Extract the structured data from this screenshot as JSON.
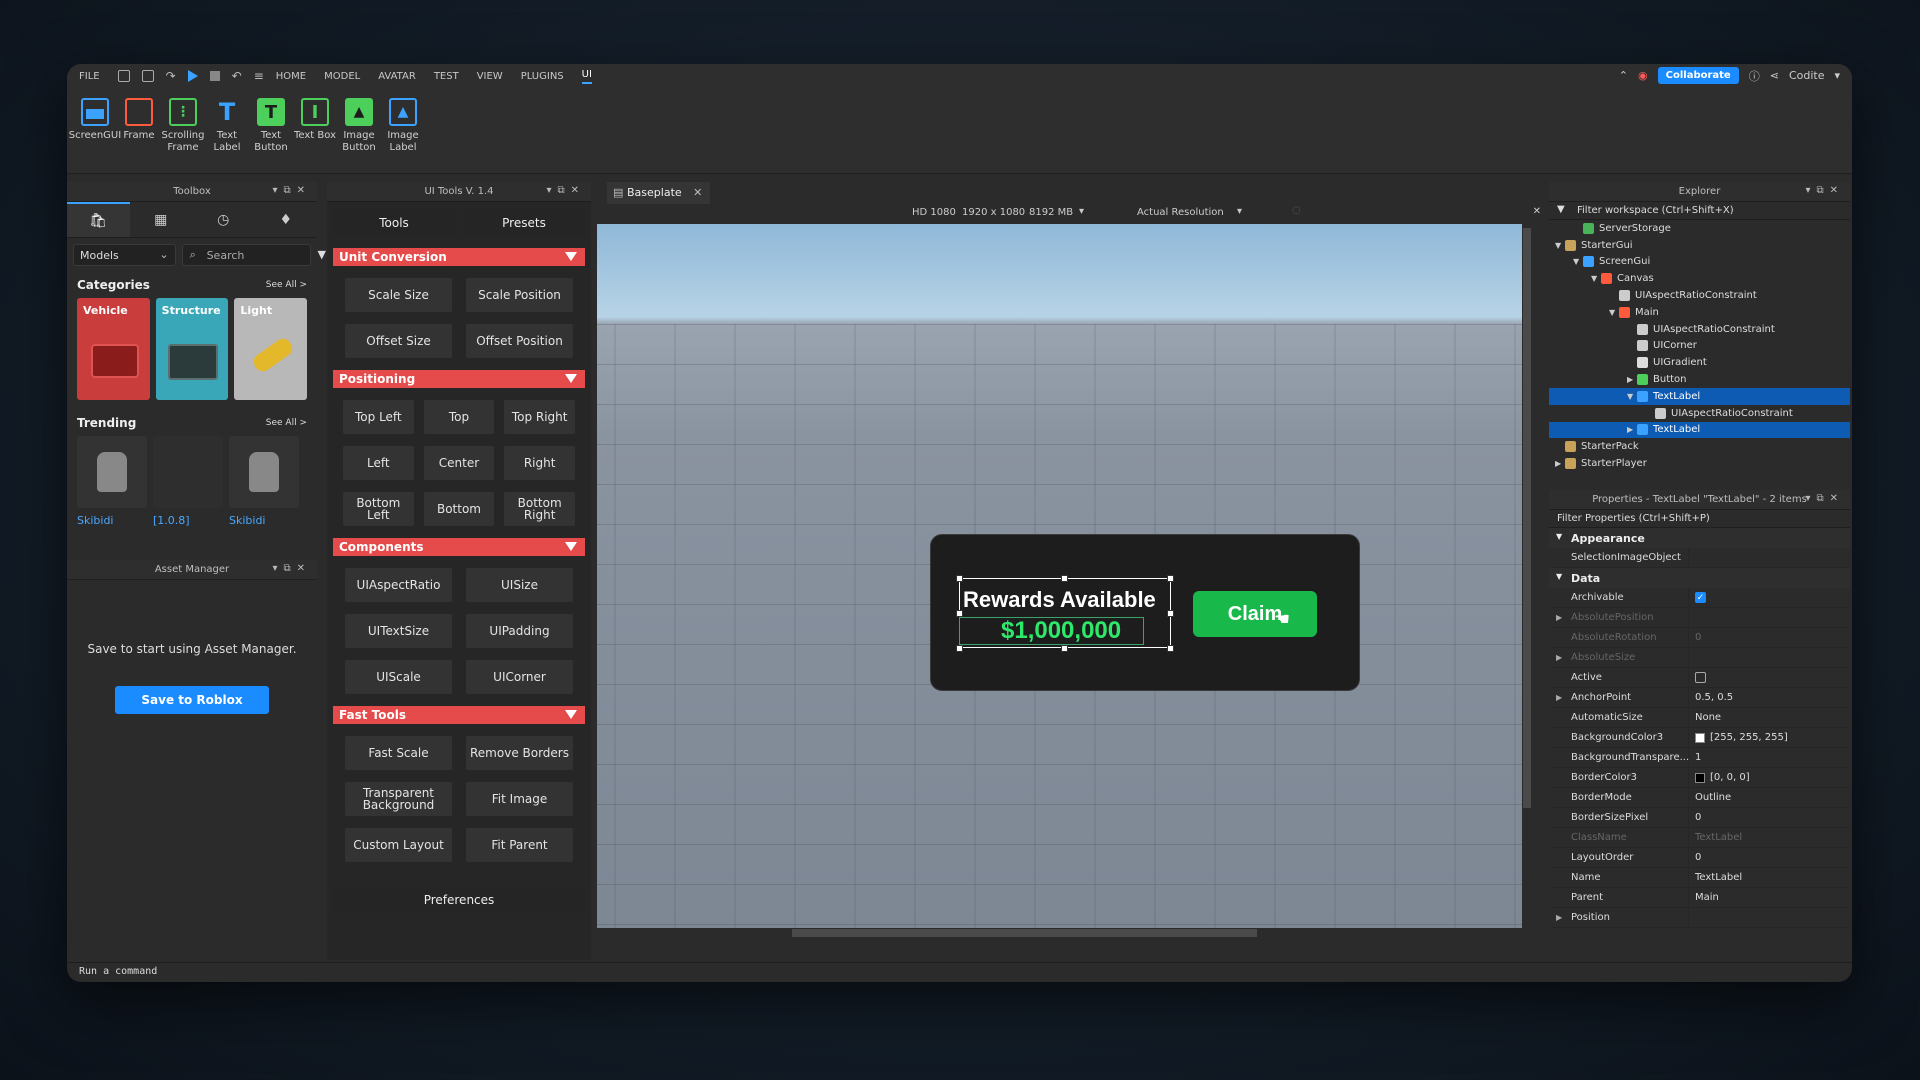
{
  "menu": {
    "items": [
      "FILE",
      "HOME",
      "MODEL",
      "AVATAR",
      "TEST",
      "VIEW",
      "PLUGINS",
      "UI"
    ],
    "active": "UI",
    "collaborate": "Collaborate",
    "user": "Codite"
  },
  "ribbon": {
    "tools": [
      {
        "label": "ScreenGUI",
        "icon": "screen-gui-icon",
        "color": "#3ba3ff"
      },
      {
        "label": "Frame",
        "icon": "frame-icon",
        "color": "#ff5a3c"
      },
      {
        "label": "Scrolling Frame",
        "icon": "scrolling-frame-icon",
        "color": "#4ccf5b"
      },
      {
        "label": "Text Label",
        "icon": "text-label-icon",
        "color": "#3ba3ff"
      },
      {
        "label": "Text Button",
        "icon": "text-button-icon",
        "color": "#4ccf5b"
      },
      {
        "label": "Text Box",
        "icon": "text-box-icon",
        "color": "#4ccf5b"
      },
      {
        "label": "Image Button",
        "icon": "image-button-icon",
        "color": "#4ccf5b"
      },
      {
        "label": "Image Label",
        "icon": "image-label-icon",
        "color": "#3ba3ff"
      }
    ]
  },
  "toolbox": {
    "title": "Toolbox",
    "dropdown": "Models",
    "search_placeholder": "Search",
    "categories_title": "Categories",
    "see_all": "See All >",
    "categories": [
      {
        "label": "Vehicle",
        "color": "#c93d3d"
      },
      {
        "label": "Structure",
        "color": "#3aa7b8"
      },
      {
        "label": "Light",
        "color": "#b8b8b8"
      }
    ],
    "trending_title": "Trending",
    "trending": [
      "Skibidi",
      "[1.0.8]",
      "Skibidi"
    ]
  },
  "asset_manager": {
    "title": "Asset Manager",
    "message": "Save to start using Asset Manager.",
    "button": "Save to Roblox"
  },
  "ui_tools": {
    "title": "UI Tools V. 1.4",
    "tabs": [
      "Tools",
      "Presets"
    ],
    "sections": [
      {
        "title": "Unit Conversion",
        "buttons": [
          "Scale Size",
          "Scale Position",
          "Offset Size",
          "Offset Position"
        ]
      },
      {
        "title": "Positioning",
        "buttons": [
          "Top Left",
          "Top",
          "Top Right",
          "Left",
          "Center",
          "Right",
          "Bottom Left",
          "Bottom",
          "Bottom Right"
        ]
      },
      {
        "title": "Components",
        "buttons": [
          "UIAspectRatio",
          "UISize",
          "UITextSize",
          "UIPadding",
          "UIScale",
          "UICorner"
        ]
      },
      {
        "title": "Fast Tools",
        "buttons": [
          "Fast Scale",
          "Remove Borders",
          "Transparent Background",
          "Fit Image",
          "Custom Layout",
          "Fit Parent"
        ]
      }
    ],
    "preferences": "Preferences"
  },
  "viewport": {
    "tab": "Baseplate",
    "device": "HD 1080",
    "resolution": "1920 x 1080",
    "memory": "8192 MB",
    "scale_mode": "Actual Resolution",
    "card": {
      "title": "Rewards Available",
      "amount": "$1,000,000",
      "button": "Claim"
    }
  },
  "explorer": {
    "title": "Explorer",
    "filter": "Filter workspace (Ctrl+Shift+X)",
    "rows": [
      {
        "label": "ServerStorage",
        "depth": 1,
        "arrow": "",
        "color": "#49b35a",
        "selected": false
      },
      {
        "label": "StarterGui",
        "depth": 0,
        "arrow": "▼",
        "color": "#c9a25a",
        "selected": false
      },
      {
        "label": "ScreenGui",
        "depth": 1,
        "arrow": "▼",
        "color": "#3ba3ff",
        "selected": false
      },
      {
        "label": "Canvas",
        "depth": 2,
        "arrow": "▼",
        "color": "#ff5a3c",
        "selected": false
      },
      {
        "label": "UIAspectRatioConstraint",
        "depth": 3,
        "arrow": "",
        "color": "#cccccc",
        "selected": false
      },
      {
        "label": "Main",
        "depth": 3,
        "arrow": "▼",
        "color": "#ff5a3c",
        "selected": false
      },
      {
        "label": "UIAspectRatioConstraint",
        "depth": 4,
        "arrow": "",
        "color": "#cccccc",
        "selected": false
      },
      {
        "label": "UICorner",
        "depth": 4,
        "arrow": "",
        "color": "#cccccc",
        "selected": false
      },
      {
        "label": "UIGradient",
        "depth": 4,
        "arrow": "",
        "color": "#dddddd",
        "selected": false
      },
      {
        "label": "Button",
        "depth": 4,
        "arrow": "▶",
        "color": "#4ccf5b",
        "selected": false
      },
      {
        "label": "TextLabel",
        "depth": 4,
        "arrow": "▼",
        "color": "#3ba3ff",
        "selected": true
      },
      {
        "label": "UIAspectRatioConstraint",
        "depth": 5,
        "arrow": "",
        "color": "#cccccc",
        "selected": false
      },
      {
        "label": "TextLabel",
        "depth": 4,
        "arrow": "▶",
        "color": "#3ba3ff",
        "selected": true
      },
      {
        "label": "StarterPack",
        "depth": 0,
        "arrow": "",
        "color": "#c9a25a",
        "selected": false
      },
      {
        "label": "StarterPlayer",
        "depth": 0,
        "arrow": "▶",
        "color": "#c9a25a",
        "selected": false
      }
    ]
  },
  "properties": {
    "title": "Properties - TextLabel \"TextLabel\" - 2 items",
    "filter": "Filter Properties (Ctrl+Shift+P)",
    "rows": [
      {
        "kind": "cat",
        "name": "Appearance"
      },
      {
        "kind": "prop",
        "name": "SelectionImageObject",
        "value": "",
        "dim": false
      },
      {
        "kind": "cat",
        "name": "Data"
      },
      {
        "kind": "prop",
        "name": "Archivable",
        "value": "",
        "check": true,
        "dim": false
      },
      {
        "kind": "prop",
        "name": "AbsolutePosition",
        "value": "",
        "dim": true,
        "expand": true
      },
      {
        "kind": "prop",
        "name": "AbsoluteRotation",
        "value": "0",
        "dim": true
      },
      {
        "kind": "prop",
        "name": "AbsoluteSize",
        "value": "",
        "dim": true,
        "expand": true
      },
      {
        "kind": "prop",
        "name": "Active",
        "value": "",
        "check": false,
        "dim": false
      },
      {
        "kind": "prop",
        "name": "AnchorPoint",
        "value": "0.5, 0.5",
        "dim": false,
        "expand": true
      },
      {
        "kind": "prop",
        "name": "AutomaticSize",
        "value": "None",
        "dim": false
      },
      {
        "kind": "prop",
        "name": "BackgroundColor3",
        "value": "[255, 255, 255]",
        "swatch": "#ffffff",
        "dim": false
      },
      {
        "kind": "prop",
        "name": "BackgroundTranspare...",
        "value": "1",
        "dim": false
      },
      {
        "kind": "prop",
        "name": "BorderColor3",
        "value": "[0, 0, 0]",
        "swatch": "#000000",
        "dim": false
      },
      {
        "kind": "prop",
        "name": "BorderMode",
        "value": "Outline",
        "dim": false
      },
      {
        "kind": "prop",
        "name": "BorderSizePixel",
        "value": "0",
        "dim": false
      },
      {
        "kind": "prop",
        "name": "ClassName",
        "value": "TextLabel",
        "dim": true
      },
      {
        "kind": "prop",
        "name": "LayoutOrder",
        "value": "0",
        "dim": false
      },
      {
        "kind": "prop",
        "name": "Name",
        "value": "TextLabel",
        "dim": false
      },
      {
        "kind": "prop",
        "name": "Parent",
        "value": "Main",
        "dim": false
      },
      {
        "kind": "prop",
        "name": "Position",
        "value": "",
        "dim": false,
        "expand": true
      }
    ]
  },
  "command_bar": {
    "placeholder": "Run a command"
  }
}
